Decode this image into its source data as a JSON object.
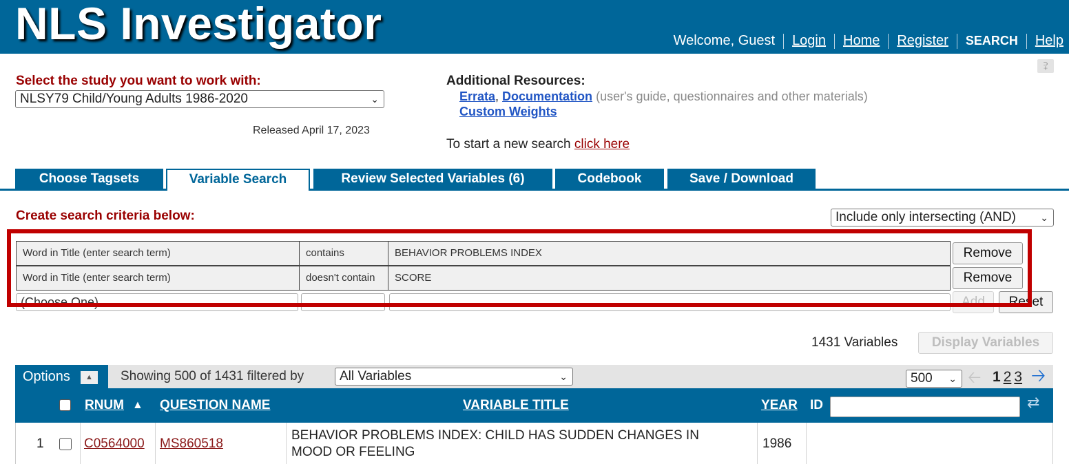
{
  "header": {
    "app_title": "NLS Investigator",
    "welcome": "Welcome, Guest",
    "nav": {
      "login": "Login",
      "home": "Home",
      "register": "Register",
      "search": "SEARCH",
      "help": "Help"
    }
  },
  "study": {
    "label": "Select the study you want to work with:",
    "selected": "NLSY79 Child/Young Adults 1986-2020",
    "released": "Released April 17, 2023"
  },
  "resources": {
    "title": "Additional Resources:",
    "errata": "Errata",
    "documentation": "Documentation",
    "doc_note": "(user's guide, questionnaires and other materials)",
    "custom_weights": "Custom Weights",
    "new_search_prefix": "To start a new search",
    "new_search_link": "click here"
  },
  "tabs": [
    {
      "label": "Choose Tagsets"
    },
    {
      "label": "Variable Search",
      "active": true
    },
    {
      "label": "Review Selected Variables (6)"
    },
    {
      "label": "Codebook"
    },
    {
      "label": "Save / Download"
    }
  ],
  "criteria": {
    "label": "Create search criteria below:",
    "logic": "Include only intersecting (AND)",
    "rows": [
      {
        "field": "Word in Title   (enter search term)",
        "operator": "contains",
        "value": "BEHAVIOR PROBLEMS INDEX",
        "remove": "Remove"
      },
      {
        "field": "Word in Title   (enter search term)",
        "operator": "doesn't contain",
        "value": "SCORE",
        "remove": "Remove"
      }
    ],
    "new_row": {
      "field_placeholder": "(Choose One)",
      "add": "Add",
      "reset": "Reset"
    }
  },
  "results": {
    "count_text": "1431 Variables",
    "display_button": "Display Variables",
    "options": "Options",
    "showing_text": "Showing 500 of 1431  filtered by",
    "filter": "All Variables",
    "page_size": "500",
    "pages": [
      "1",
      "2",
      "3"
    ],
    "current_page": "1",
    "columns": {
      "rnum": "RNUM",
      "question_name": "QUESTION NAME",
      "variable_title": "VARIABLE TITLE",
      "year": "YEAR",
      "id": "ID"
    },
    "rows": [
      {
        "index": "1",
        "rnum": "C0564000",
        "question_name": "MS860518",
        "title_line1": "BEHAVIOR PROBLEMS INDEX: CHILD HAS SUDDEN CHANGES IN",
        "title_line2": "MOOD OR FEELING",
        "year": "1986"
      }
    ]
  },
  "colors": {
    "brand_blue": "#006699",
    "accent_red": "#990000",
    "highlight_red": "#c00000",
    "link_blue": "#2055c4"
  },
  "icons": [
    "collapse-icon",
    "chevron-down-icon",
    "sort-asc-icon",
    "prev-arrow-icon",
    "next-arrow-icon",
    "swap-icon"
  ]
}
